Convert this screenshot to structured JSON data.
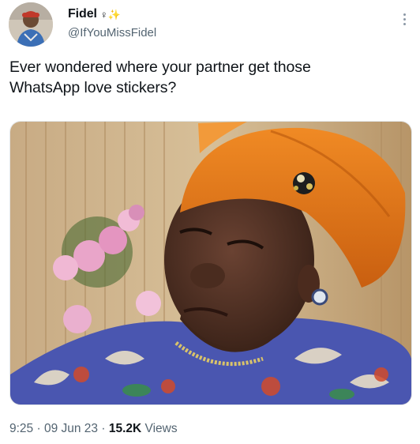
{
  "user": {
    "display_name": "Fidel",
    "name_emoji": "♀✨",
    "handle": "@IfYouMissFidel"
  },
  "tweet": {
    "text_line1": "Ever wondered where your partner get those",
    "text_line2": "WhatsApp love stickers?"
  },
  "meta": {
    "time": "9:25",
    "sep1": " · ",
    "date": "09 Jun 23",
    "sep2": " · ",
    "views_count": "15.2K",
    "views_label": " Views"
  },
  "icons": {
    "more": "more-vertical-icon"
  },
  "colors": {
    "text_primary": "#0f1419",
    "text_secondary": "#536471",
    "headwrap": "#e67a1c"
  }
}
